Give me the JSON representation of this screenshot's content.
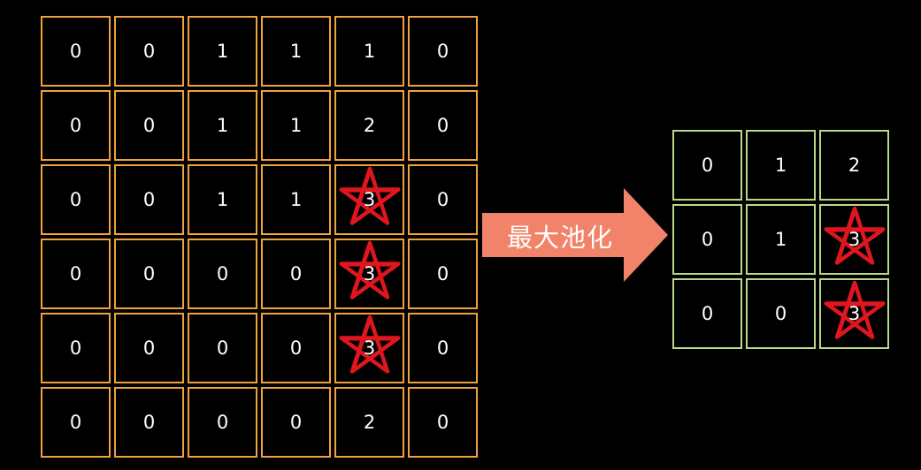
{
  "colors": {
    "input_border": "#f0a23c",
    "output_border": "#b9d98a",
    "arrow_fill": "#f2836a",
    "star_stroke": "#e0161f",
    "text": "#ffffff",
    "background": "#000000"
  },
  "input_grid": {
    "rows": [
      [
        "0",
        "0",
        "1",
        "1",
        "1",
        "0"
      ],
      [
        "0",
        "0",
        "1",
        "1",
        "2",
        "0"
      ],
      [
        "0",
        "0",
        "1",
        "1",
        "3",
        "0"
      ],
      [
        "0",
        "0",
        "0",
        "0",
        "3",
        "0"
      ],
      [
        "0",
        "0",
        "0",
        "0",
        "3",
        "0"
      ],
      [
        "0",
        "0",
        "0",
        "0",
        "2",
        "0"
      ]
    ],
    "starred": [
      [
        2,
        4
      ],
      [
        3,
        4
      ],
      [
        4,
        4
      ]
    ]
  },
  "arrow": {
    "label": "最大池化",
    "icon": "right-arrow-icon"
  },
  "output_grid": {
    "rows": [
      [
        "0",
        "1",
        "2"
      ],
      [
        "0",
        "1",
        "3"
      ],
      [
        "0",
        "0",
        "3"
      ]
    ],
    "starred": [
      [
        1,
        2
      ],
      [
        2,
        2
      ]
    ]
  },
  "star_icon": "star-icon"
}
